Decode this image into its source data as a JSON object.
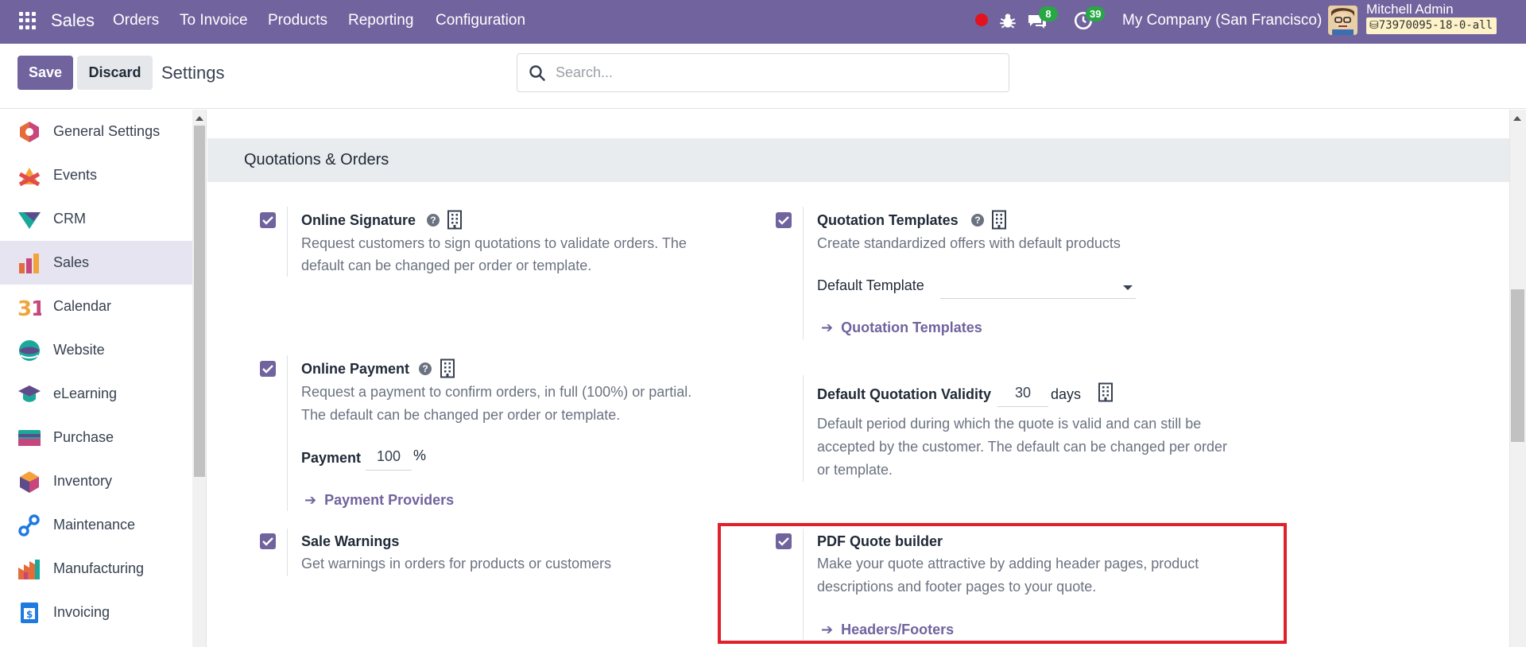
{
  "navbar": {
    "brand": "Sales",
    "menu": [
      "Orders",
      "To Invoice",
      "Products",
      "Reporting",
      "Configuration"
    ],
    "messages_count": "8",
    "activities_count": "39",
    "company": "My Company (San Francisco)",
    "user_name": "Mitchell Admin",
    "db_name": "73970095-18-0-all"
  },
  "control": {
    "save_label": "Save",
    "discard_label": "Discard",
    "title": "Settings",
    "search_placeholder": "Search..."
  },
  "sidebar": {
    "items": [
      {
        "label": "General Settings",
        "icon": "general-settings-icon"
      },
      {
        "label": "Events",
        "icon": "events-icon"
      },
      {
        "label": "CRM",
        "icon": "crm-icon"
      },
      {
        "label": "Sales",
        "icon": "sales-icon",
        "active": true
      },
      {
        "label": "Calendar",
        "icon": "calendar-icon"
      },
      {
        "label": "Website",
        "icon": "website-icon"
      },
      {
        "label": "eLearning",
        "icon": "elearning-icon"
      },
      {
        "label": "Purchase",
        "icon": "purchase-icon"
      },
      {
        "label": "Inventory",
        "icon": "inventory-icon"
      },
      {
        "label": "Maintenance",
        "icon": "maintenance-icon"
      },
      {
        "label": "Manufacturing",
        "icon": "manufacturing-icon"
      },
      {
        "label": "Invoicing",
        "icon": "invoicing-icon"
      }
    ]
  },
  "section": {
    "title": "Quotations & Orders",
    "online_signature": {
      "title": "Online Signature",
      "desc1": "Request customers to sign quotations to validate orders. The",
      "desc2": "default can be changed per order or template.",
      "checked": true
    },
    "quotation_templates": {
      "title": "Quotation Templates",
      "desc": "Create standardized offers with default products",
      "field_label": "Default Template",
      "field_value": "",
      "link": "Quotation Templates",
      "checked": true
    },
    "online_payment": {
      "title": "Online Payment",
      "desc1": "Request a payment to confirm orders, in full (100%) or partial.",
      "desc2": "The default can be changed per order or template.",
      "field_label": "Payment",
      "field_value": "100",
      "field_unit": "%",
      "link": "Payment Providers",
      "checked": true
    },
    "default_validity": {
      "title": "Default Quotation Validity",
      "value": "30",
      "unit": "days",
      "desc1": "Default period during which the quote is valid and can still be",
      "desc2": "accepted by the customer. The default can be changed per order",
      "desc3": "or template."
    },
    "sale_warnings": {
      "title": "Sale Warnings",
      "desc": "Get warnings in orders for products or customers",
      "checked": true
    },
    "pdf_quote_builder": {
      "title": "PDF Quote builder",
      "desc1": "Make your quote attractive by adding header pages, product",
      "desc2": "descriptions and footer pages to your quote.",
      "link": "Headers/Footers",
      "checked": true
    }
  },
  "colors": {
    "brand": "#71639e",
    "highlight": "#e0202a",
    "badge": "#28a745"
  }
}
